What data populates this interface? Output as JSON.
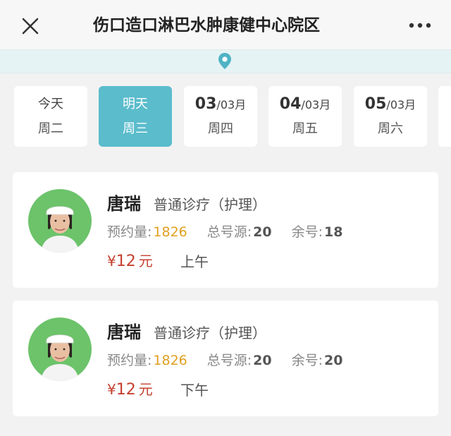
{
  "header": {
    "title": "伤口造口淋巴水肿康健中心院区"
  },
  "dates": [
    {
      "line1": "今天",
      "line2": "周二",
      "selected": false
    },
    {
      "line1": "明天",
      "line2": "周三",
      "selected": true
    },
    {
      "day": "03",
      "month": "/03月",
      "weekday": "周四"
    },
    {
      "day": "04",
      "month": "/03月",
      "weekday": "周五"
    },
    {
      "day": "05",
      "month": "/03月",
      "weekday": "周六"
    }
  ],
  "labels": {
    "booked": "预约量:",
    "total": "总号源:",
    "remaining": "余号:",
    "currency": "¥",
    "price_unit": "元"
  },
  "doctors": [
    {
      "name": "唐瑞",
      "dept": "普通诊疗（护理）",
      "booked": "1826",
      "total": "20",
      "remaining": "18",
      "price": "12",
      "period": "上午"
    },
    {
      "name": "唐瑞",
      "dept": "普通诊疗（护理）",
      "booked": "1826",
      "total": "20",
      "remaining": "20",
      "price": "12",
      "period": "下午"
    }
  ],
  "colors": {
    "accent": "#5bbccc",
    "price": "#c5402f",
    "booked_count": "#e0a020"
  },
  "icons": [
    "close-icon",
    "more-icon",
    "location-pin-icon",
    "avatar"
  ]
}
